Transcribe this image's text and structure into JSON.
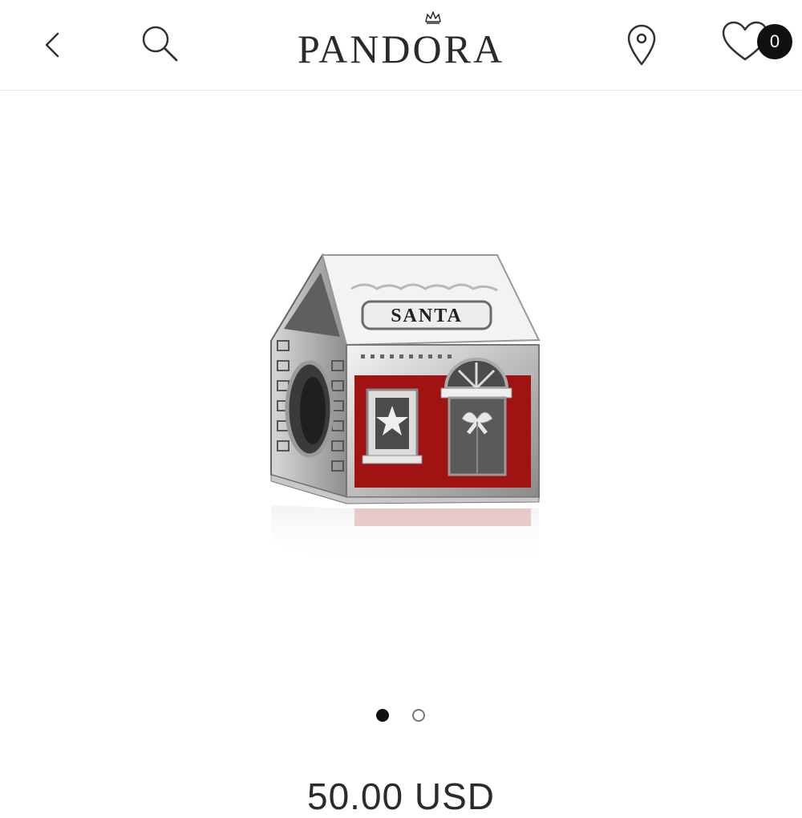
{
  "header": {
    "logo": "PANDORA",
    "wishlist_count": "0",
    "icons": [
      "chevron-left-icon",
      "search-icon",
      "location-pin-icon",
      "heart-icon"
    ]
  },
  "product": {
    "image_engraving": "SANTA",
    "price": "50.00 USD"
  },
  "carousel": {
    "total_slides": 2,
    "active_index": 0
  },
  "colors": {
    "enamel_red": "#a11212",
    "badge_bg": "#111111",
    "text": "#2a2a2a"
  }
}
